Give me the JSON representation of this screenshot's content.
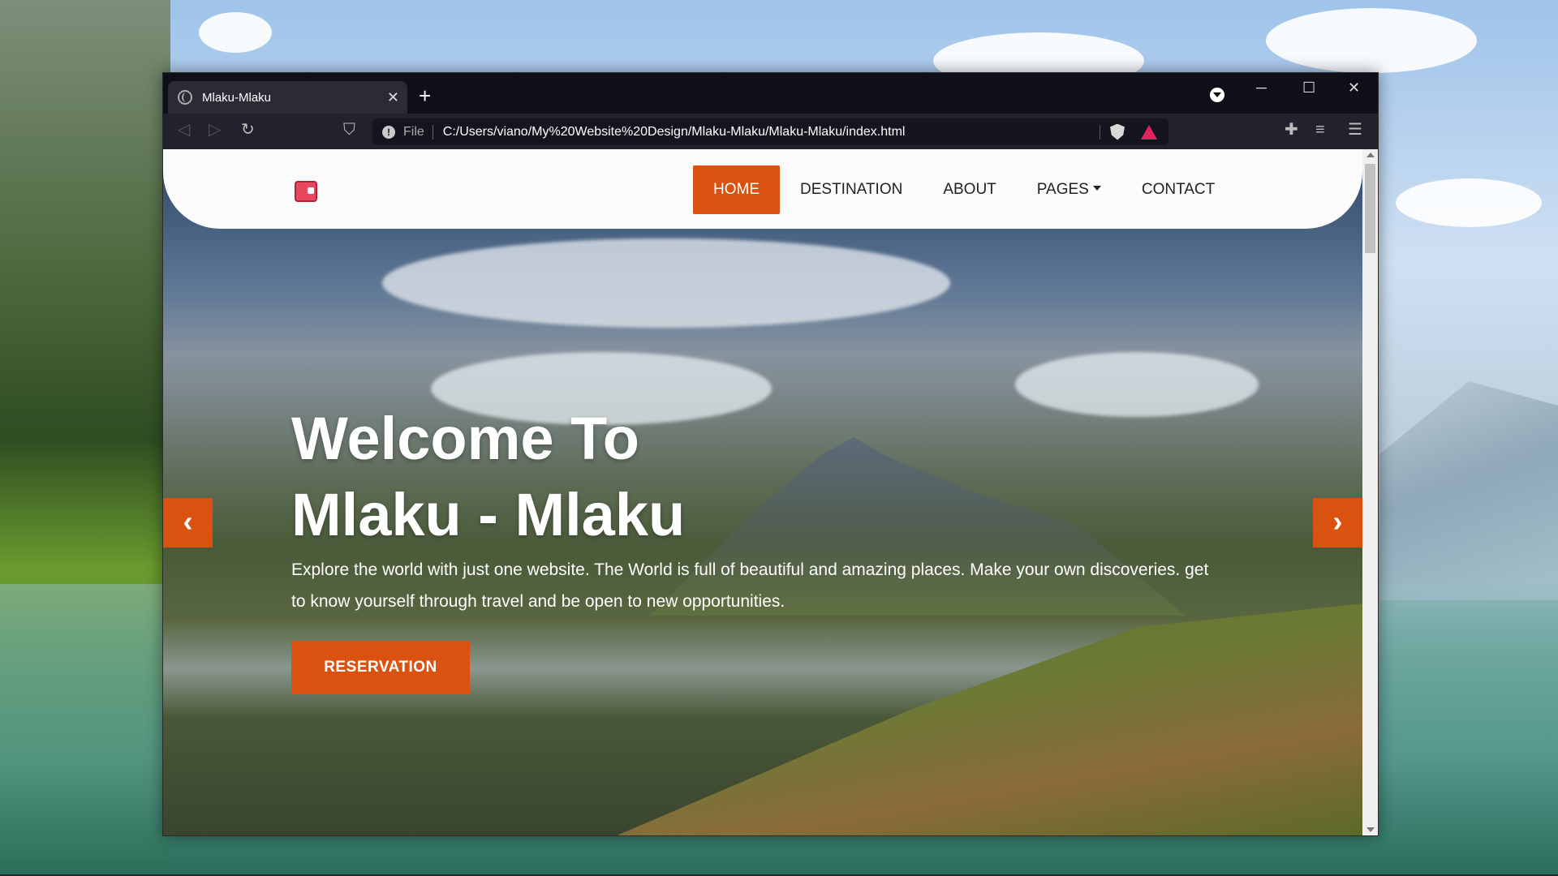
{
  "browser": {
    "tab_title": "Mlaku-Mlaku",
    "tab_close": "✕",
    "new_tab": "+",
    "url_scheme": "File",
    "url": "C:/Users/viano/My%20Website%20Design/Mlaku-Mlaku/Mlaku-Mlaku/index.html",
    "window_controls": {
      "minimize": "─",
      "maximize": "☐",
      "close": "✕"
    },
    "icons": [
      "back-icon",
      "forward-icon",
      "reload-icon",
      "bookmark-icon",
      "info-icon",
      "brave-shield-icon",
      "brave-rewards-icon",
      "extensions-icon",
      "playlist-icon",
      "menu-icon"
    ]
  },
  "site": {
    "nav": {
      "items": [
        {
          "label": "HOME",
          "active": true
        },
        {
          "label": "DESTINATION",
          "active": false
        },
        {
          "label": "ABOUT",
          "active": false
        },
        {
          "label": "PAGES",
          "active": false,
          "dropdown": true
        },
        {
          "label": "CONTACT",
          "active": false
        }
      ]
    },
    "hero": {
      "title_line1": "Welcome To",
      "title_line2": "Mlaku - Mlaku",
      "text": "Explore the world with just one website. The World is full of beautiful and amazing places. Make your own discoveries. get to know yourself through travel and be open to new opportunities.",
      "cta_label": "RESERVATION",
      "prev": "‹",
      "next": "›"
    },
    "colors": {
      "accent": "#d9520f",
      "nav_bg": "#fbfbfc"
    }
  }
}
